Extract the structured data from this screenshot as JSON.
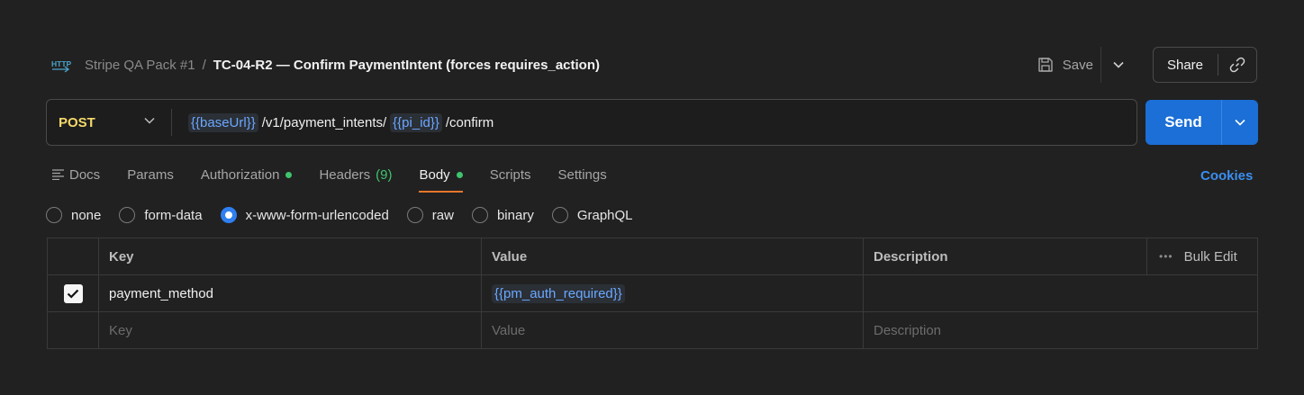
{
  "header": {
    "icon": "http-icon",
    "collection": "Stripe QA Pack #1",
    "separator": "/",
    "request_name": "TC-04-R2 — Confirm PaymentIntent (forces requires_action)",
    "save_label": "Save",
    "share_label": "Share"
  },
  "request": {
    "method": "POST",
    "url_parts": {
      "var1": "{{baseUrl}}",
      "path1": "/v1/payment_intents/",
      "var2": "{{pi_id}}",
      "path2": "/confirm"
    },
    "send_label": "Send"
  },
  "tabs": {
    "docs": "Docs",
    "params": "Params",
    "authorization": "Authorization",
    "headers": "Headers",
    "headers_count": "(9)",
    "body": "Body",
    "scripts": "Scripts",
    "settings": "Settings",
    "cookies": "Cookies"
  },
  "body_types": {
    "none": "none",
    "form_data": "form-data",
    "urlencoded": "x-www-form-urlencoded",
    "raw": "raw",
    "binary": "binary",
    "graphql": "GraphQL",
    "selected": "x-www-form-urlencoded"
  },
  "table": {
    "headers": {
      "key": "Key",
      "value": "Value",
      "description": "Description",
      "bulk_edit": "Bulk Edit"
    },
    "rows": [
      {
        "checked": true,
        "key": "payment_method",
        "value": "{{pm_auth_required}}",
        "description": ""
      }
    ],
    "placeholders": {
      "key": "Key",
      "value": "Value",
      "description": "Description"
    }
  },
  "colors": {
    "background": "#212121",
    "accent_blue": "#1b6fd6",
    "method_yellow": "#f5d96b",
    "variable_blue": "#6aa8ff",
    "active_tab_underline": "#e8762b",
    "status_green": "#3ec46d"
  }
}
